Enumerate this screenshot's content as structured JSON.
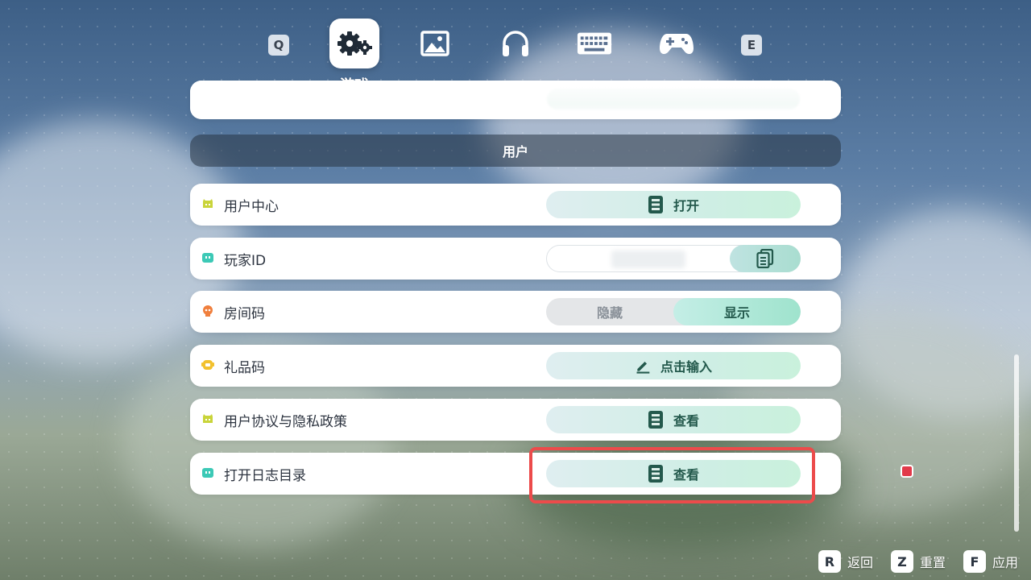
{
  "tabs": {
    "prev_key": "Q",
    "next_key": "E",
    "active_label": "游戏",
    "items": [
      "gear-icon",
      "image-icon",
      "headphones-icon",
      "keyboard-icon",
      "gamepad-icon"
    ]
  },
  "section_title": "用户",
  "rows": {
    "user_center": {
      "label": "用户中心",
      "button": "打开"
    },
    "player_id": {
      "label": "玩家ID"
    },
    "room_code": {
      "label": "房间码",
      "hide": "隐藏",
      "show": "显示",
      "selected": "显示"
    },
    "gift_code": {
      "label": "礼品码",
      "button": "点击输入"
    },
    "agreement": {
      "label": "用户协议与隐私政策",
      "button": "查看"
    },
    "log_dir": {
      "label": "打开日志目录",
      "button": "查看"
    }
  },
  "footer": {
    "back_key": "R",
    "back_label": "返回",
    "reset_key": "Z",
    "reset_label": "重置",
    "apply_key": "F",
    "apply_label": "应用"
  },
  "colors": {
    "accent_text": "#23594c",
    "highlight": "#ec4b4b",
    "icon_yellow": "#c9d43a",
    "icon_teal": "#3cc9b6",
    "icon_orange": "#f07f3d",
    "icon_gold": "#f2c12e"
  }
}
